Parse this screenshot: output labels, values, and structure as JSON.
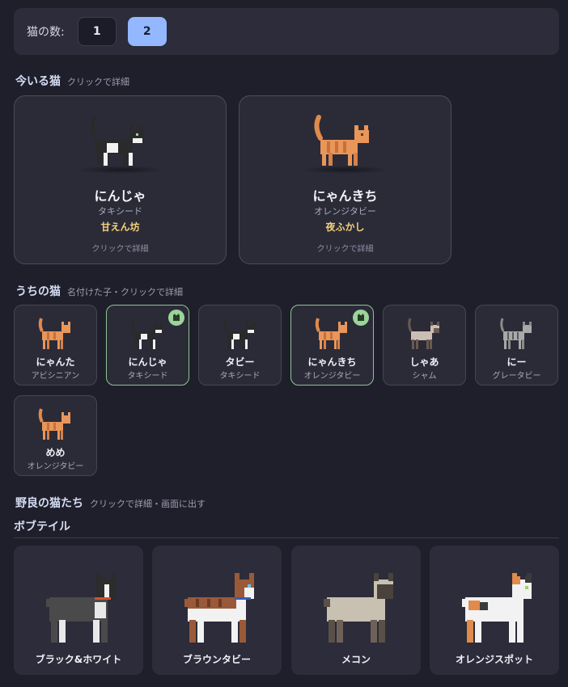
{
  "count": {
    "label": "猫の数:",
    "options": [
      "1",
      "2"
    ],
    "selected": "2"
  },
  "current": {
    "title": "今いる猫",
    "hint": "クリックで詳細",
    "cats": [
      {
        "name": "にんじゃ",
        "breed": "タキシード",
        "trait": "甘えん坊",
        "hint": "クリックで詳細",
        "coat": "tuxedo"
      },
      {
        "name": "にゃんきち",
        "breed": "オレンジタビー",
        "trait": "夜ふかし",
        "hint": "クリックで詳細",
        "coat": "orange"
      }
    ]
  },
  "ours": {
    "title": "うちの猫",
    "hint": "名付けた子・クリックで詳細",
    "cats": [
      {
        "name": "にゃんた",
        "breed": "アビシニアン",
        "coat": "orange",
        "active": false
      },
      {
        "name": "にんじゃ",
        "breed": "タキシード",
        "coat": "tuxedo",
        "active": true
      },
      {
        "name": "タビー",
        "breed": "タキシード",
        "coat": "tuxedo",
        "active": false
      },
      {
        "name": "にゃんきち",
        "breed": "オレンジタビー",
        "coat": "orange",
        "active": true
      },
      {
        "name": "しゃあ",
        "breed": "シャム",
        "coat": "siamese",
        "active": false
      },
      {
        "name": "にー",
        "breed": "グレータビー",
        "coat": "grey",
        "active": false
      },
      {
        "name": "めめ",
        "breed": "オレンジタビー",
        "coat": "orange",
        "active": false
      }
    ]
  },
  "strays": {
    "title": "野良の猫たち",
    "hint": "クリックで詳細・画面に出す",
    "group": "ボブテイル",
    "cats": [
      {
        "name": "ブラック&ホワイト",
        "coat": "bw"
      },
      {
        "name": "ブラウンタビー",
        "coat": "brown"
      },
      {
        "name": "メコン",
        "coat": "mekong"
      },
      {
        "name": "オレンジスポット",
        "coat": "calico"
      }
    ]
  },
  "colors": {
    "accent": "#93b8ff",
    "active_border": "#8fc493",
    "trait": "#f3d27a",
    "background": "#1f1f2b",
    "card": "#2b2b38"
  }
}
